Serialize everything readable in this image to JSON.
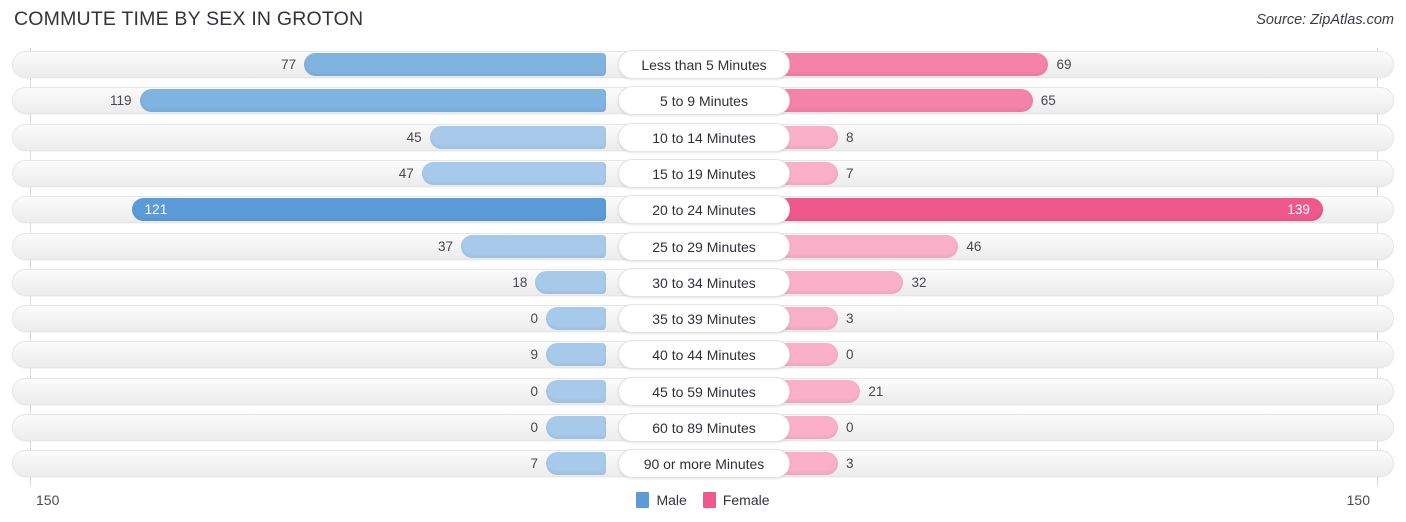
{
  "header": {
    "title": "COMMUTE TIME BY SEX IN GROTON",
    "source": "Source: ZipAtlas.com"
  },
  "legend": {
    "male_label": "Male",
    "female_label": "Female",
    "male_color": "#5B9BD8",
    "female_color": "#F0588C"
  },
  "axis": {
    "left_max": "150",
    "right_max": "150"
  },
  "chart_data": {
    "type": "bar",
    "title": "COMMUTE TIME BY SEX IN GROTON",
    "subtitle": "Source: ZipAtlas.com",
    "orientation": "horizontal-diverging",
    "xlabel": "",
    "ylabel": "",
    "xlim": [
      150,
      150
    ],
    "grid": false,
    "legend_position": "bottom-center",
    "categories": [
      "Less than 5 Minutes",
      "5 to 9 Minutes",
      "10 to 14 Minutes",
      "15 to 19 Minutes",
      "20 to 24 Minutes",
      "25 to 29 Minutes",
      "30 to 34 Minutes",
      "35 to 39 Minutes",
      "40 to 44 Minutes",
      "45 to 59 Minutes",
      "60 to 89 Minutes",
      "90 or more Minutes"
    ],
    "series": [
      {
        "name": "Male",
        "values": [
          77,
          119,
          45,
          47,
          121,
          37,
          18,
          0,
          9,
          0,
          0,
          7
        ]
      },
      {
        "name": "Female",
        "values": [
          69,
          65,
          8,
          7,
          139,
          46,
          32,
          3,
          0,
          21,
          0,
          3
        ]
      }
    ]
  },
  "rows": [
    {
      "label": "Less than 5 Minutes",
      "male": 77,
      "female": 69,
      "male_text": "77",
      "female_text": "69"
    },
    {
      "label": "5 to 9 Minutes",
      "male": 119,
      "female": 65,
      "male_text": "119",
      "female_text": "65"
    },
    {
      "label": "10 to 14 Minutes",
      "male": 45,
      "female": 8,
      "male_text": "45",
      "female_text": "8"
    },
    {
      "label": "15 to 19 Minutes",
      "male": 47,
      "female": 7,
      "male_text": "47",
      "female_text": "7"
    },
    {
      "label": "20 to 24 Minutes",
      "male": 121,
      "female": 139,
      "male_text": "121",
      "female_text": "139"
    },
    {
      "label": "25 to 29 Minutes",
      "male": 37,
      "female": 46,
      "male_text": "37",
      "female_text": "46"
    },
    {
      "label": "30 to 34 Minutes",
      "male": 18,
      "female": 32,
      "male_text": "18",
      "female_text": "32"
    },
    {
      "label": "35 to 39 Minutes",
      "male": 0,
      "female": 3,
      "male_text": "0",
      "female_text": "3"
    },
    {
      "label": "40 to 44 Minutes",
      "male": 9,
      "female": 0,
      "male_text": "9",
      "female_text": "0"
    },
    {
      "label": "45 to 59 Minutes",
      "male": 0,
      "female": 21,
      "male_text": "0",
      "female_text": "21"
    },
    {
      "label": "60 to 89 Minutes",
      "male": 0,
      "female": 0,
      "male_text": "0",
      "female_text": "0"
    },
    {
      "label": "90 or more Minutes",
      "male": 7,
      "female": 3,
      "male_text": "7",
      "female_text": "3"
    }
  ]
}
